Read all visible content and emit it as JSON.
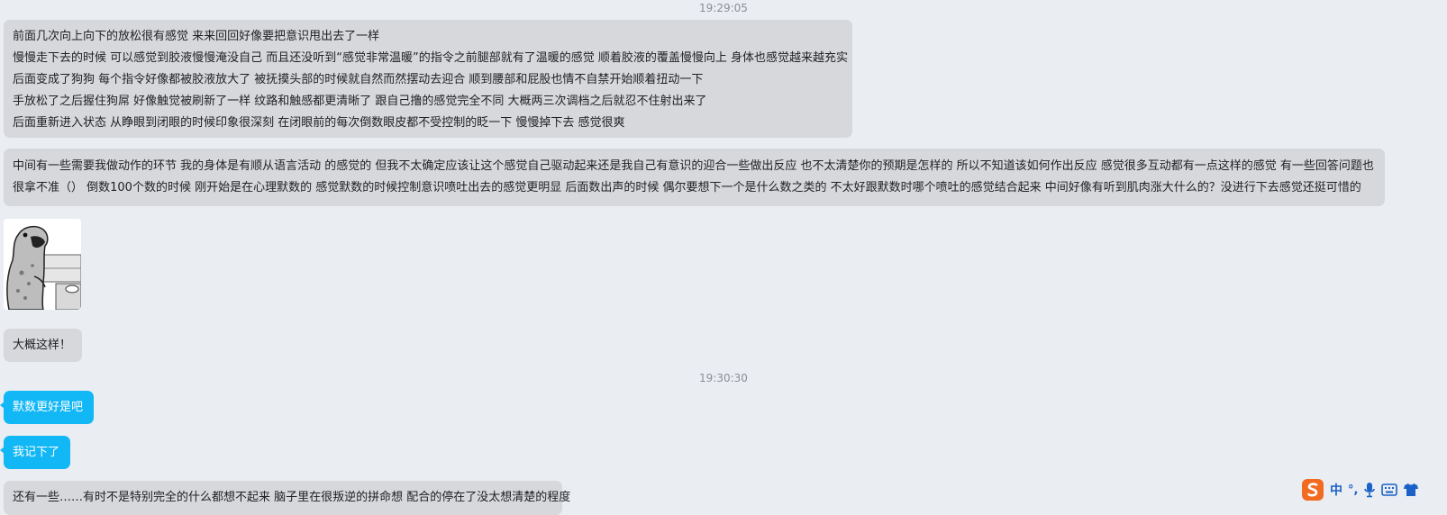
{
  "chat": {
    "timestamps": [
      "19:29:05",
      "19:30:30"
    ],
    "messages": [
      {
        "lines": [
          "前面几次向上向下的放松很有感觉 来来回回好像要把意识甩出去了一样",
          "慢慢走下去的时候 可以感觉到胶液慢慢淹没自己 而且还没听到“感觉非常温暖”的指令之前腿部就有了温暖的感觉 顺着胶液的覆盖慢慢向上 身体也感觉越来越充实",
          "后面变成了狗狗 每个指令好像都被胶液放大了 被抚摸头部的时候就自然而然摆动去迎合 顺到腰部和屁股也情不自禁开始顺着扭动一下",
          "手放松了之后握住狗屌 好像触觉被刷新了一样 纹路和触感都更清晰了 跟自己撸的感觉完全不同 大概两三次调档之后就忍不住射出来了",
          "后面重新进入状态 从睁眼到闭眼的时候印象很深刻 在闭眼前的每次倒数眼皮都不受控制的眨一下 慢慢掉下去 感觉很爽"
        ]
      },
      {
        "text": "中间有一些需要我做动作的环节 我的身体是有顺从语言活动 的感觉的 但我不太确定应该让这个感觉自己驱动起来还是我自己有意识的迎合一些做出反应 也不太清楚你的预期是怎样的 所以不知道该如何作出反应 感觉很多互动都有一点这样的感觉 有一些回答问题也很拿不准（） 倒数100个数的时候 刚开始是在心理默数的 感觉默数的时候控制意识喷吐出去的感觉更明显 后面数出声的时候 偶尔要想下一个是什么数之类的 不太好跟默数时哪个喷吐的感觉结合起来 中间好像有听到肌肉涨大什么的？没进行下去感觉还挺可惜的"
      },
      {
        "text": "大概这样！"
      },
      {
        "text": "默数更好是吧"
      },
      {
        "text": "我记下了"
      },
      {
        "text": "还有一些……有时不是特别完全的什么都想不起来 脑子里在很叛逆的拼命想 配合的停在了没太想清楚的程度"
      }
    ],
    "sticker_icon": "dinosaur-sticker-icon"
  },
  "ime_toolbar": {
    "mode_label": "中",
    "punct_label": "°,",
    "icons": [
      "sogou-logo-icon",
      "microphone-icon",
      "keyboard-icon",
      "shirt-icon"
    ]
  },
  "colors": {
    "background": "#eaedf2",
    "incoming_bubble": "#d7d8dc",
    "outgoing_bubble": "#12b7f5",
    "timestamp_text": "#8b8f96",
    "ime_accent": "#1a62c7",
    "sogou_orange": "#f26b21"
  }
}
